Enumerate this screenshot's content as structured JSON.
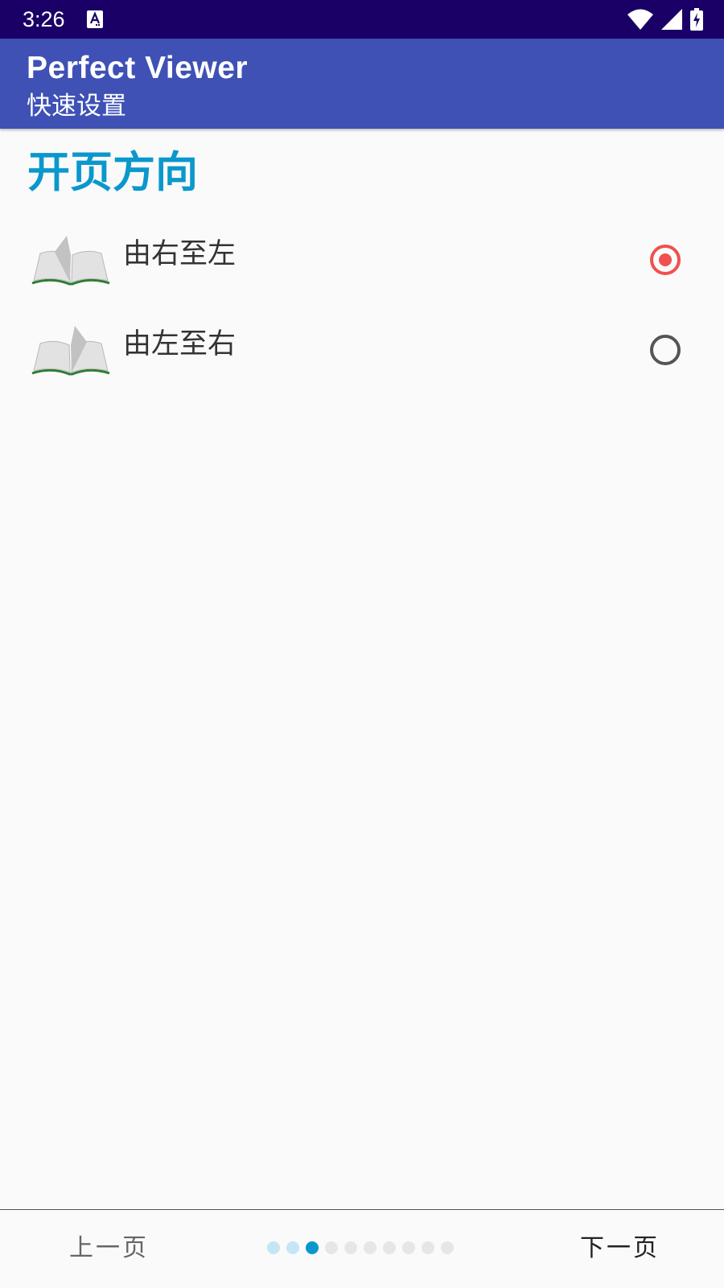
{
  "status_bar": {
    "time": "3:26",
    "notification_icon": "autofill-a-icon",
    "icons": [
      "wifi-icon",
      "cell-signal-icon",
      "battery-charging-icon"
    ],
    "background": "#1a0066"
  },
  "app_bar": {
    "title": "Perfect Viewer",
    "subtitle": "快速设置",
    "background": "#3f51b5"
  },
  "section": {
    "title": "开页方向",
    "color": "#0a98cc"
  },
  "options": [
    {
      "label": "由右至左",
      "icon": "open-book-icon",
      "selected": true
    },
    {
      "label": "由左至右",
      "icon": "open-book-icon",
      "selected": false
    }
  ],
  "navigation": {
    "prev_label": "上一页",
    "next_label": "下一页",
    "page_count": 10,
    "current_page": 3
  },
  "colors": {
    "accent": "#f05050",
    "dot_active": "#0a98cc",
    "dot_visited": "#c4e6f4",
    "dot_inactive": "#e6e6e6"
  }
}
